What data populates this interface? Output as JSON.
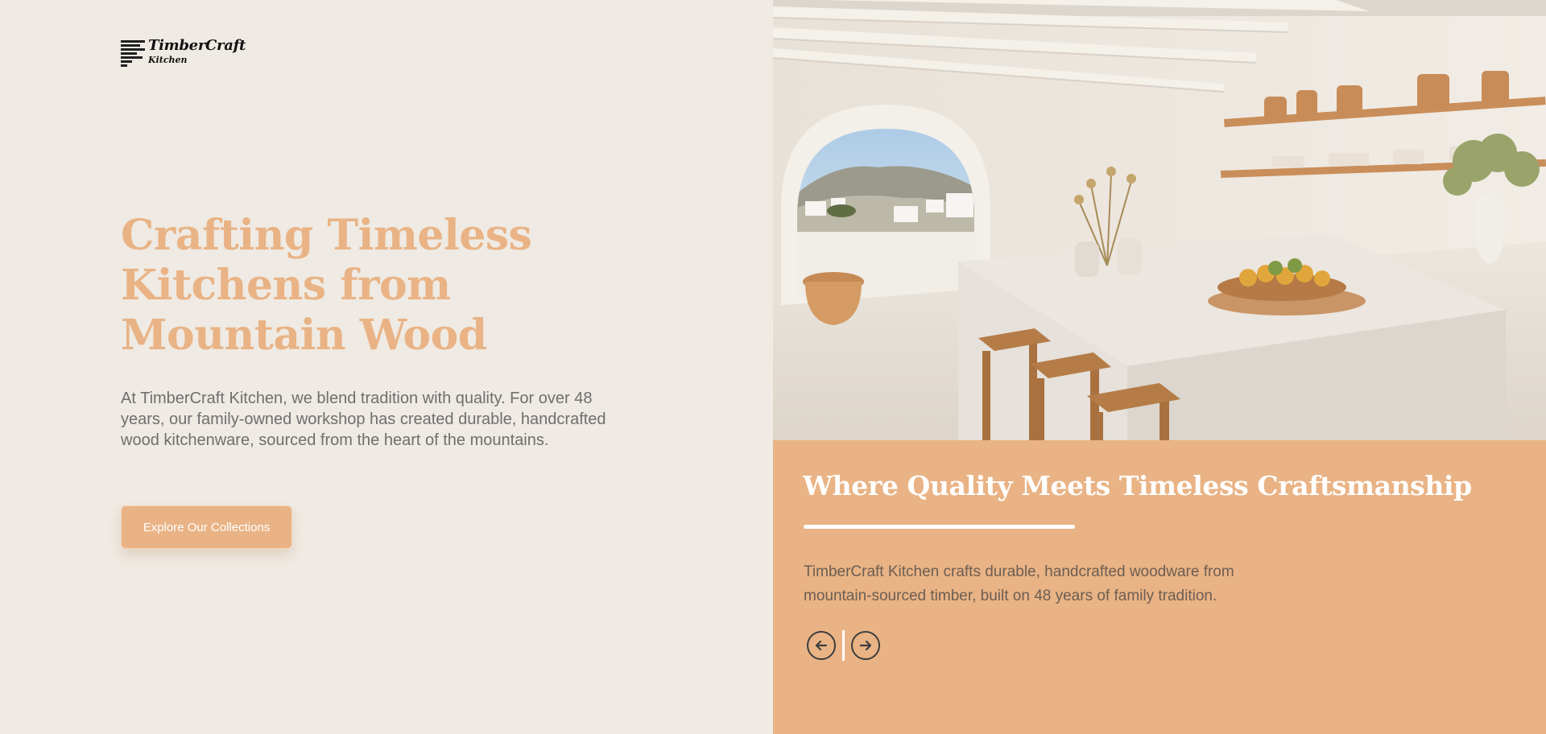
{
  "brand": {
    "name": "TimberCraft",
    "sub": "Kitchen",
    "icon": "logo-lines-icon"
  },
  "hero": {
    "title": "Crafting Timeless Kitchens from Mountain Wood",
    "description": "At TimberCraft Kitchen, we blend tradition with quality. For over 48 years, our family-owned workshop has created durable, handcrafted wood kitchenware, sourced from the heart of the mountains.",
    "cta_label": "Explore Our Collections"
  },
  "panel": {
    "title": "Where Quality Meets Timeless Craftsmanship",
    "description": "TimberCraft Kitchen crafts durable, handcrafted woodware from mountain-sourced timber, built on 48 years of family tradition.",
    "prev_icon": "arrow-left-circle-icon",
    "next_icon": "arrow-right-circle-icon"
  },
  "colors": {
    "page_bg": "#efeae3",
    "accent": "#e9b385",
    "text_muted": "#6f6f6f",
    "white": "#ffffff"
  }
}
